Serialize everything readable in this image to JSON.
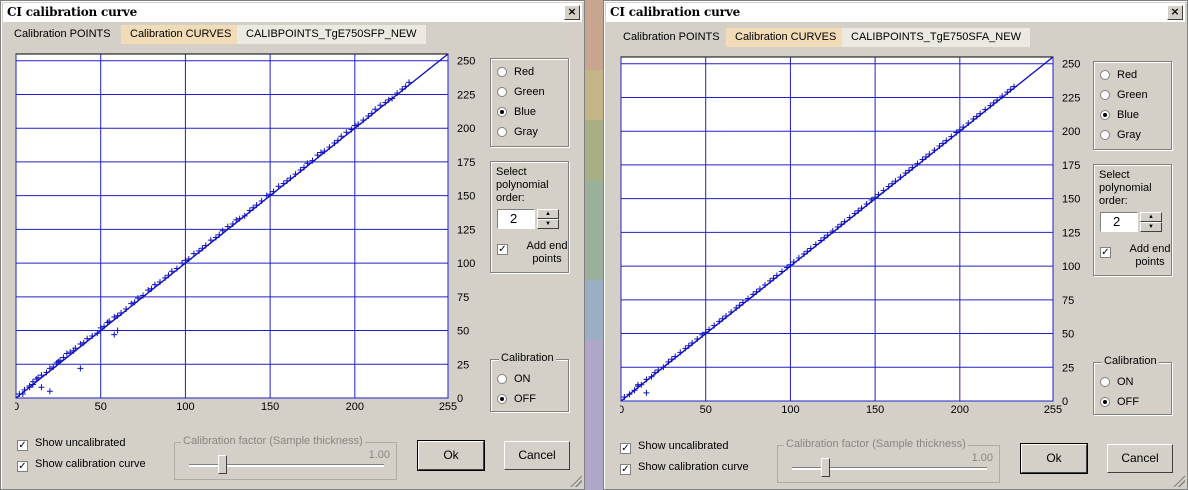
{
  "colors": {
    "curve": "#1010c0",
    "grid": "#2020c8",
    "active_tab": "#f2dcb8"
  },
  "windows": [
    {
      "title": "CI calibration curve",
      "close_glyph": "×",
      "tabs": {
        "points": "Calibration POINTS",
        "curves": "Calibration CURVES",
        "file": "CALIBPOINTS_TgE750SFP_NEW"
      },
      "channels": {
        "options": [
          "Red",
          "Green",
          "Blue",
          "Gray"
        ],
        "selected": "Blue"
      },
      "polynomial": {
        "label": "Select polynomial order:",
        "value": "2",
        "add_end_points_label": "Add end points",
        "add_end_points_checked": true
      },
      "calibration": {
        "label": "Calibration",
        "options": [
          "ON",
          "OFF"
        ],
        "selected": "OFF"
      },
      "show_uncalibrated": {
        "label": "Show uncalibrated",
        "checked": true
      },
      "show_curve": {
        "label": "Show calibration curve",
        "checked": true
      },
      "calibration_factor": {
        "label": "Calibration factor (Sample thickness)",
        "value": "1.00",
        "level": 0.17
      },
      "ok_label": "Ok",
      "cancel_label": "Cancel",
      "chart_data": {
        "type": "scatter",
        "title": "",
        "xlabel": "",
        "ylabel": "",
        "xlim": [
          0,
          255
        ],
        "ylim": [
          0,
          255
        ],
        "x_ticks": [
          0,
          50,
          100,
          150,
          200,
          255
        ],
        "y_ticks": [
          0,
          25,
          50,
          75,
          100,
          125,
          150,
          175,
          200,
          225,
          250
        ],
        "grid": true,
        "series": [
          {
            "kind": "line",
            "x": [
              0,
              255
            ],
            "y": [
              0,
              255
            ]
          },
          {
            "kind": "points",
            "x": [
              2,
              5,
              8,
              10,
              12,
              13,
              15,
              18,
              20,
              22,
              24,
              25,
              26,
              28,
              30,
              32,
              34,
              35,
              38,
              40,
              42,
              45,
              48,
              50,
              52,
              54,
              55,
              58,
              60,
              62,
              65,
              68,
              70,
              72,
              75,
              78,
              80,
              82,
              85,
              88,
              90,
              92,
              95,
              98,
              100,
              102,
              105,
              108,
              110,
              112,
              115,
              118,
              120,
              122,
              125,
              128,
              130,
              132,
              135,
              138,
              140,
              142,
              145,
              148,
              150,
              152,
              155,
              158,
              160,
              162,
              165,
              168,
              170,
              172,
              175,
              178,
              180,
              182,
              185,
              188,
              190,
              192,
              195,
              198,
              200,
              202,
              205,
              208,
              210,
              212,
              215,
              218,
              220,
              222,
              225,
              228,
              230,
              232,
              10,
              15,
              20,
              38,
              58,
              60,
              8,
              4
            ],
            "y": [
              3,
              6,
              9,
              12,
              14,
              15,
              17,
              19,
              22,
              23,
              26,
              27,
              28,
              30,
              33,
              34,
              35,
              37,
              40,
              41,
              44,
              46,
              48,
              52,
              53,
              56,
              57,
              60,
              61,
              63,
              66,
              70,
              71,
              74,
              76,
              80,
              81,
              84,
              86,
              89,
              91,
              94,
              96,
              100,
              102,
              103,
              107,
              109,
              111,
              113,
              117,
              119,
              121,
              124,
              127,
              129,
              132,
              133,
              135,
              139,
              141,
              143,
              146,
              150,
              151,
              153,
              157,
              159,
              161,
              163,
              166,
              169,
              171,
              174,
              176,
              180,
              182,
              183,
              186,
              189,
              191,
              194,
              197,
              199,
              202,
              203,
              206,
              209,
              211,
              214,
              217,
              219,
              221,
              222,
              226,
              229,
              231,
              234,
              10,
              8,
              5,
              22,
              47,
              50,
              8,
              3
            ]
          }
        ]
      }
    },
    {
      "title": "CI calibration curve",
      "close_glyph": "×",
      "tabs": {
        "points": "Calibration POINTS",
        "curves": "Calibration CURVES",
        "file": "CALIBPOINTS_TgE750SFA_NEW"
      },
      "channels": {
        "options": [
          "Red",
          "Green",
          "Blue",
          "Gray"
        ],
        "selected": "Blue"
      },
      "polynomial": {
        "label": "Select polynomial order:",
        "value": "2",
        "add_end_points_label": "Add end points",
        "add_end_points_checked": true
      },
      "calibration": {
        "label": "Calibration",
        "options": [
          "ON",
          "OFF"
        ],
        "selected": "OFF"
      },
      "show_uncalibrated": {
        "label": "Show uncalibrated",
        "checked": true
      },
      "show_curve": {
        "label": "Show calibration curve",
        "checked": true
      },
      "calibration_factor": {
        "label": "Calibration factor (Sample thickness)",
        "value": "1.00",
        "level": 0.17
      },
      "ok_label": "Ok",
      "cancel_label": "Cancel",
      "chart_data": {
        "type": "scatter",
        "title": "",
        "xlabel": "",
        "ylabel": "",
        "xlim": [
          0,
          255
        ],
        "ylim": [
          0,
          255
        ],
        "x_ticks": [
          0,
          50,
          100,
          150,
          200,
          255
        ],
        "y_ticks": [
          0,
          25,
          50,
          75,
          100,
          125,
          150,
          175,
          200,
          225,
          250
        ],
        "grid": true,
        "series": [
          {
            "kind": "line",
            "x": [
              0,
              255
            ],
            "y": [
              0,
              255
            ]
          },
          {
            "kind": "points",
            "x": [
              2,
              5,
              8,
              10,
              12,
              15,
              18,
              20,
              22,
              25,
              28,
              30,
              32,
              35,
              38,
              40,
              42,
              45,
              48,
              50,
              52,
              55,
              58,
              60,
              62,
              65,
              68,
              70,
              72,
              75,
              78,
              80,
              82,
              85,
              88,
              90,
              92,
              95,
              98,
              100,
              102,
              105,
              108,
              110,
              112,
              115,
              118,
              120,
              122,
              125,
              128,
              130,
              132,
              135,
              138,
              140,
              142,
              145,
              148,
              150,
              152,
              155,
              158,
              160,
              162,
              165,
              168,
              170,
              172,
              175,
              178,
              180,
              182,
              185,
              188,
              190,
              192,
              195,
              198,
              200,
              202,
              205,
              208,
              210,
              212,
              215,
              218,
              220,
              222,
              225,
              228,
              230,
              232,
              15,
              10
            ],
            "y": [
              3,
              5,
              8,
              11,
              12,
              16,
              18,
              21,
              23,
              25,
              29,
              31,
              33,
              36,
              39,
              41,
              43,
              46,
              49,
              51,
              53,
              56,
              59,
              61,
              63,
              66,
              69,
              71,
              73,
              76,
              79,
              81,
              83,
              86,
              89,
              91,
              93,
              96,
              99,
              101,
              103,
              106,
              109,
              111,
              113,
              116,
              119,
              121,
              123,
              126,
              129,
              131,
              133,
              136,
              139,
              141,
              143,
              146,
              149,
              151,
              153,
              156,
              159,
              161,
              163,
              166,
              169,
              171,
              173,
              176,
              179,
              181,
              183,
              186,
              189,
              191,
              193,
              196,
              199,
              201,
              203,
              206,
              209,
              211,
              213,
              216,
              219,
              221,
              223,
              226,
              229,
              231,
              233,
              6,
              12
            ]
          }
        ]
      }
    }
  ]
}
